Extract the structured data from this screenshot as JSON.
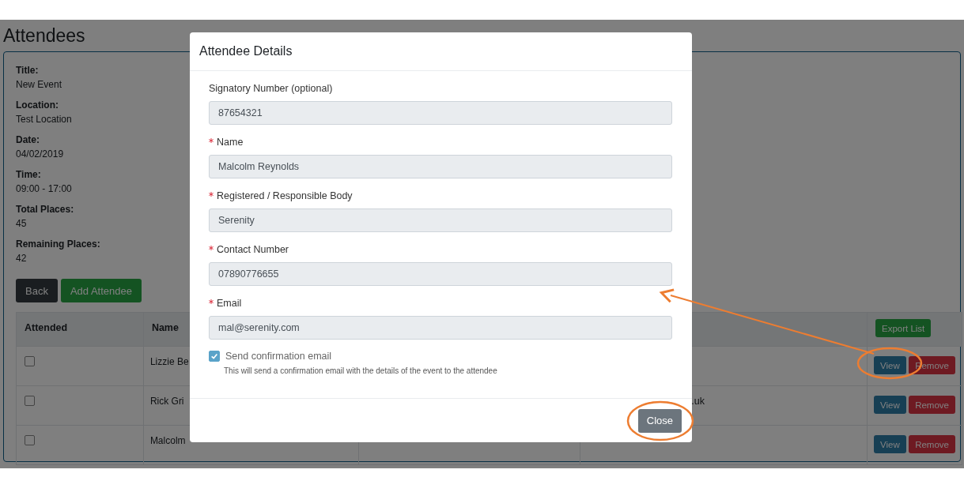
{
  "page": {
    "title": "Attendees"
  },
  "event_details": [
    {
      "label": "Title:",
      "value": "New Event"
    },
    {
      "label": "Location:",
      "value": "Test Location"
    },
    {
      "label": "Date:",
      "value": "04/02/2019"
    },
    {
      "label": "Time:",
      "value": "09:00 - 17:00"
    },
    {
      "label": "Total Places:",
      "value": "45"
    },
    {
      "label": "Remaining Places:",
      "value": "42"
    }
  ],
  "buttons": [
    {
      "label": "Back",
      "kind": "secondary"
    },
    {
      "label": "Add Attendee",
      "kind": "success"
    }
  ],
  "table": {
    "columns": [
      "Attended",
      "Name"
    ],
    "export_button": "Export List",
    "rows": [
      {
        "attended": false,
        "name": "Lizzie Be",
        "actions": [
          "View",
          "Remove"
        ]
      },
      {
        "attended": false,
        "name": "Rick Gri",
        "column_4": ".uk",
        "actions": [
          "View",
          "Remove"
        ]
      },
      {
        "attended": false,
        "name": "Malcolm",
        "actions": [
          "View",
          "Remove"
        ]
      }
    ]
  },
  "modal": {
    "title": "Attendee Details",
    "fields": [
      {
        "label": "Signatory Number (optional)",
        "required": false,
        "value": "87654321"
      },
      {
        "label": "Name",
        "required": true,
        "value": "Malcolm Reynolds"
      },
      {
        "label": "Registered / Responsible Body",
        "required": true,
        "value": "Serenity"
      },
      {
        "label": "Contact Number",
        "required": true,
        "value": "07890776655"
      },
      {
        "label": "Email",
        "required": true,
        "value": "mal@serenity.com"
      }
    ],
    "confirmation": {
      "label": "Send confirmation email",
      "checked": true,
      "help": "This will send a confirmation email with the details of the event to the attendee"
    },
    "close_button": "Close"
  }
}
